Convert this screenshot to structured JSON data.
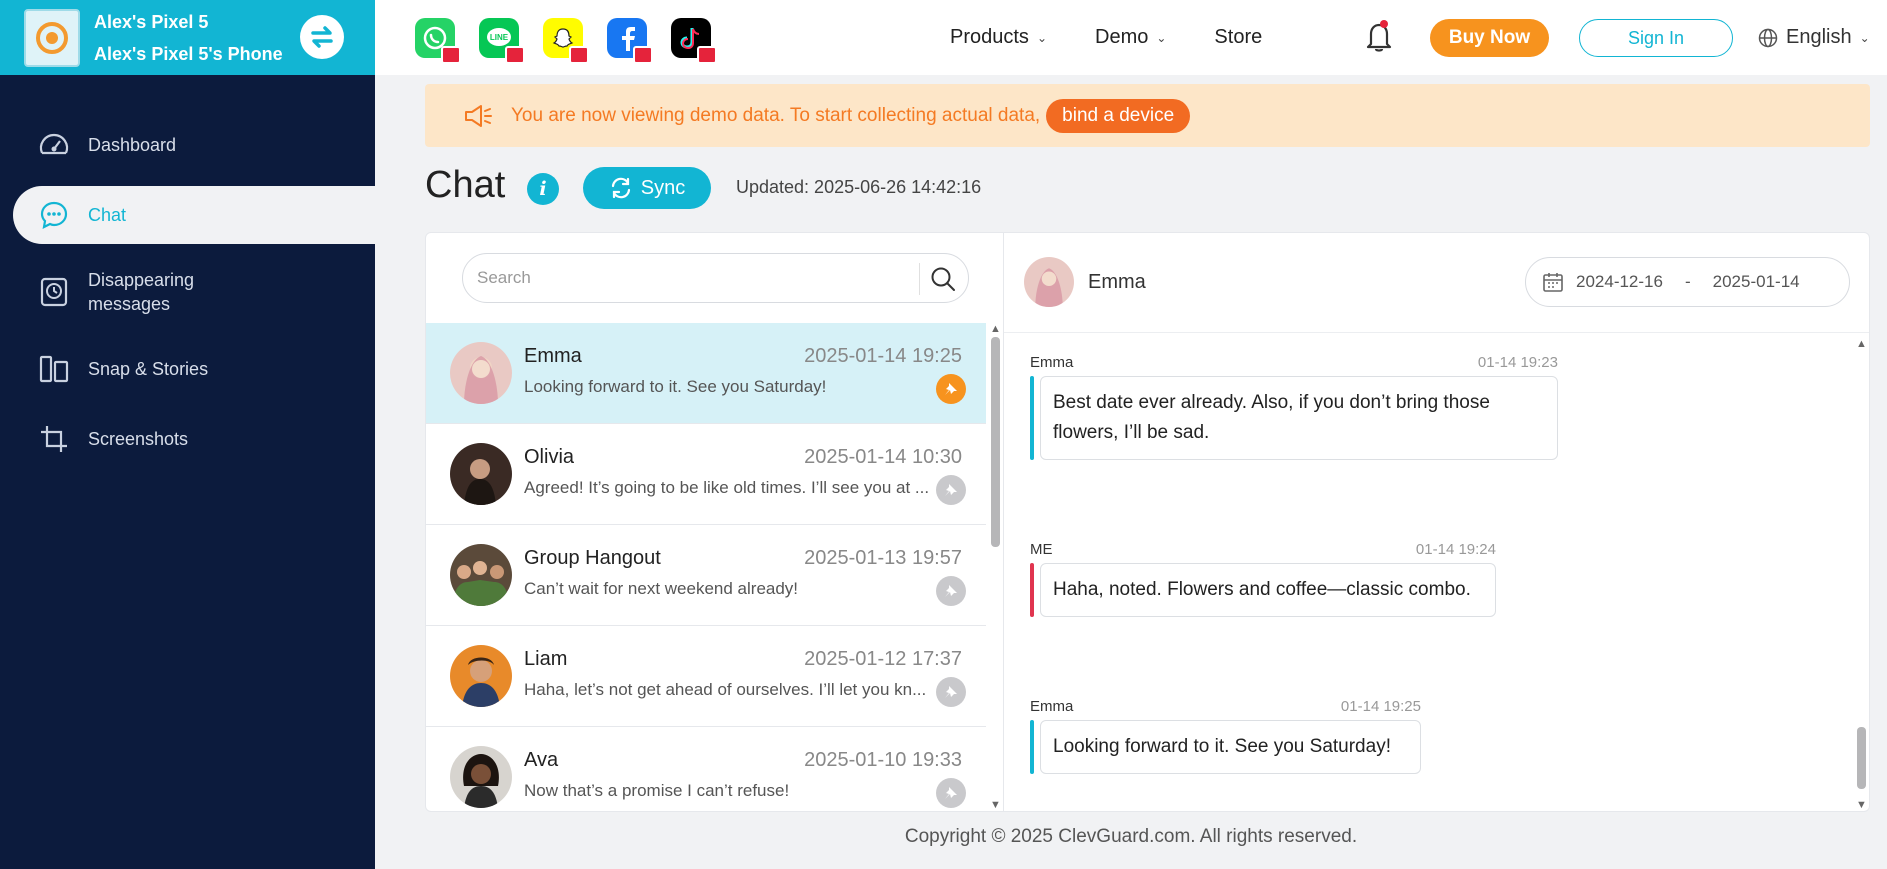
{
  "device": {
    "name": "Alex's Pixel 5",
    "phone": "Alex's Pixel 5's Phone"
  },
  "sidebar": {
    "items": [
      {
        "label": "Dashboard",
        "icon": "gauge-icon"
      },
      {
        "label": "Chat",
        "icon": "chat-bubble-icon"
      },
      {
        "label": "Disappearing messages",
        "icon": "clock-phone-icon"
      },
      {
        "label": "Snap & Stories",
        "icon": "stories-icon"
      },
      {
        "label": "Screenshots",
        "icon": "crop-icon"
      }
    ]
  },
  "topbar": {
    "apps": [
      {
        "name": "whatsapp",
        "icon": "whatsapp-icon",
        "color": "#25d366"
      },
      {
        "name": "line",
        "icon": "line-icon",
        "color": "#06c755"
      },
      {
        "name": "snapchat",
        "icon": "snapchat-icon",
        "color": "#fffc00"
      },
      {
        "name": "facebook",
        "icon": "facebook-icon",
        "color": "#1877f2"
      },
      {
        "name": "tiktok",
        "icon": "tiktok-icon",
        "color": "#000000"
      }
    ],
    "nav": {
      "products": "Products",
      "demo": "Demo",
      "store": "Store"
    },
    "buy_now": "Buy Now",
    "sign_in": "Sign In",
    "language": "English"
  },
  "banner": {
    "text": "You are now viewing demo data. To start collecting actual data,",
    "button": "bind a device"
  },
  "page": {
    "title": "Chat",
    "sync": "Sync",
    "updated": "Updated: 2025-06-26 14:42:16"
  },
  "search": {
    "placeholder": "Search"
  },
  "conversations": [
    {
      "name": "Emma",
      "time": "2025-01-14 19:25",
      "preview": "Looking forward to it. See you Saturday!",
      "pinned": true,
      "active": true
    },
    {
      "name": "Olivia",
      "time": "2025-01-14 10:30",
      "preview": "Agreed! It’s going to be like old times. I’ll see you at ...",
      "pinned": false
    },
    {
      "name": "Group Hangout",
      "time": "2025-01-13 19:57",
      "preview": "Can’t wait for next weekend already!",
      "pinned": false
    },
    {
      "name": "Liam",
      "time": "2025-01-12 17:37",
      "preview": "Haha, let’s not get ahead of ourselves. I’ll let you kn...",
      "pinned": false
    },
    {
      "name": "Ava",
      "time": "2025-01-10 19:33",
      "preview": "Now that’s a promise I can’t refuse!",
      "pinned": false
    }
  ],
  "chat": {
    "contact": "Emma",
    "date_from": "2024-12-16",
    "date_sep": "-",
    "date_to": "2025-01-14",
    "messages": [
      {
        "sender": "Emma",
        "time": "01-14 19:23",
        "text": "Best date ever already. Also, if you don’t bring those flowers, I’ll be sad.",
        "from_me": false
      },
      {
        "sender": "ME",
        "time": "01-14 19:24",
        "text": "Haha, noted. Flowers and coffee—classic combo.",
        "from_me": true
      },
      {
        "sender": "Emma",
        "time": "01-14 19:25",
        "text": "Looking forward to it. See you Saturday!",
        "from_me": false
      }
    ]
  },
  "footer": "Copyright © 2025 ClevGuard.com. All rights reserved.",
  "colors": {
    "accent": "#12b5d3",
    "sidebar": "#0c1b3d",
    "orange": "#f7931e",
    "me_bar": "#e0344f"
  }
}
